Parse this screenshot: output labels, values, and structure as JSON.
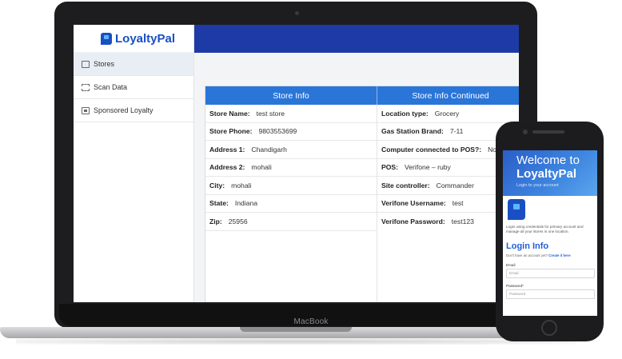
{
  "laptop": {
    "brand": "MacBook",
    "app": {
      "logo_text": "LoyaltyPal",
      "sidebar": {
        "items": [
          {
            "label": "Stores",
            "icon": "store-icon"
          },
          {
            "label": "Scan Data",
            "icon": "scan-icon"
          },
          {
            "label": "Sponsored Loyalty",
            "icon": "sponsored-icon"
          }
        ]
      },
      "table": {
        "headers": [
          "Store Info",
          "Store Info Continued"
        ],
        "left": [
          {
            "key": "Store Name:",
            "value": "test store"
          },
          {
            "key": "Store Phone:",
            "value": "9803553699"
          },
          {
            "key": "Address 1:",
            "value": "Chandigarh"
          },
          {
            "key": "Address 2:",
            "value": "mohali"
          },
          {
            "key": "City:",
            "value": "mohali"
          },
          {
            "key": "State:",
            "value": "Indiana"
          },
          {
            "key": "Zip:",
            "value": "25956"
          }
        ],
        "right": [
          {
            "key": "Location type:",
            "value": "Grocery"
          },
          {
            "key": "Gas Station Brand:",
            "value": "7-11"
          },
          {
            "key": "Computer connected to POS?:",
            "value": "No"
          },
          {
            "key": "POS:",
            "value": "Verifone – ruby"
          },
          {
            "key": "Site controller:",
            "value": "Commander"
          },
          {
            "key": "Verifone Username:",
            "value": "test"
          },
          {
            "key": "Verifone Password:",
            "value": "test123"
          }
        ]
      }
    }
  },
  "phone": {
    "welcome": "Welcome to",
    "brand": "LoyaltyPal",
    "hero_sub": "Login to your account",
    "description": "Login using credentials for primary account and manage all your stores in one location.",
    "login_title": "Login Info",
    "no_account": "Don't have an account yet?",
    "create_link": "Create it here",
    "email_label": "Email",
    "email_placeholder": "Email",
    "password_label": "Password*",
    "password_placeholder": "Password"
  },
  "colors": {
    "brand_blue": "#1a4fc4",
    "header_blue": "#2a75d8",
    "topbar_blue": "#1e3aa6"
  }
}
